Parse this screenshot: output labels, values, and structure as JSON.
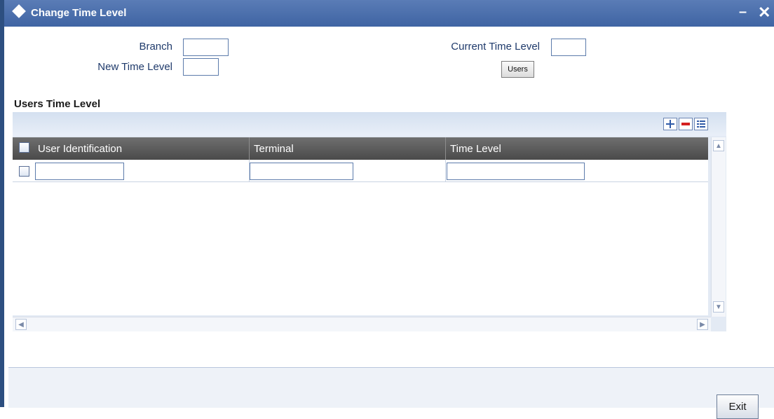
{
  "window": {
    "title": "Change Time Level"
  },
  "form": {
    "branch_label": "Branch",
    "new_time_level_label": "New Time Level",
    "current_time_level_label": "Current Time Level",
    "users_button": "Users",
    "branch_value": "",
    "new_time_level_value": "",
    "current_time_level_value": ""
  },
  "grid": {
    "section_title": "Users Time Level",
    "columns": [
      "User Identification",
      "Terminal",
      "Time Level"
    ],
    "rows": [
      {
        "user": "",
        "terminal": "",
        "time_level": ""
      }
    ],
    "toolbar_icons": [
      "add-row-icon",
      "delete-row-icon",
      "view-list-icon"
    ]
  },
  "footer": {
    "exit_button": "Exit"
  },
  "colors": {
    "titlebar": "#4a6fae",
    "label": "#1f3a6b",
    "header": "#5c5c5c"
  }
}
